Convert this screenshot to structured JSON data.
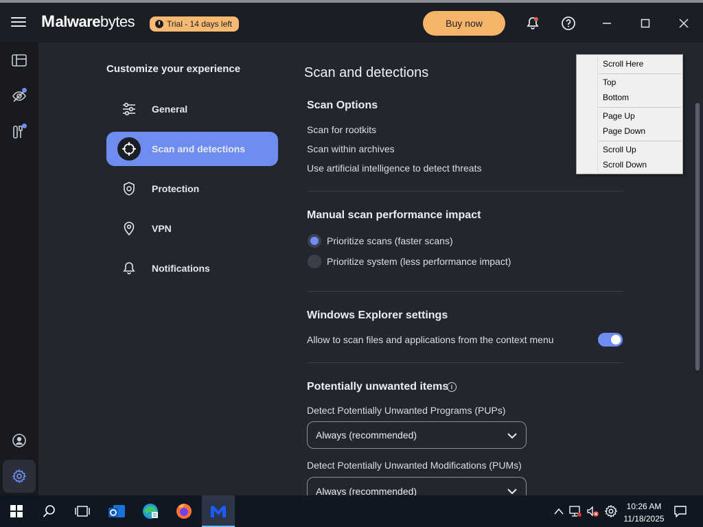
{
  "app": {
    "name_initial": "M",
    "name_rest_bold": "alware",
    "name_rest": "bytes",
    "trial_badge": "Trial - 14 days left",
    "buy_now": "Buy now"
  },
  "settings_nav": {
    "title": "Customize your experience",
    "items": [
      {
        "label": "General"
      },
      {
        "label": "Scan and detections"
      },
      {
        "label": "Protection"
      },
      {
        "label": "VPN"
      },
      {
        "label": "Notifications"
      }
    ]
  },
  "page": {
    "title": "Scan and detections",
    "scan_options": {
      "heading": "Scan Options",
      "items": [
        "Scan for rootkits",
        "Scan within archives",
        "Use artificial intelligence to detect threats"
      ]
    },
    "performance": {
      "heading": "Manual scan performance impact",
      "options": [
        "Prioritize scans (faster scans)",
        "Prioritize system (less performance impact)"
      ],
      "selected_index": 0
    },
    "explorer": {
      "heading": "Windows Explorer settings",
      "label": "Allow to scan files and applications from the context menu",
      "enabled": true
    },
    "pup": {
      "heading": "Potentially unwanted items",
      "pup_label": "Detect Potentially Unwanted Programs (PUPs)",
      "pup_value": "Always (recommended)",
      "pum_label": "Detect Potentially Unwanted Modifications (PUMs)",
      "pum_value": "Always (recommended)"
    }
  },
  "context_menu": {
    "items": [
      "Scroll Here",
      "Top",
      "Bottom",
      "Page Up",
      "Page Down",
      "Scroll Up",
      "Scroll Down"
    ]
  },
  "taskbar": {
    "time": "10:26 AM",
    "date": "11/18/2025"
  },
  "colors": {
    "accent": "#6f8df0",
    "buy": "#f5b46a",
    "background": "#22262e"
  }
}
